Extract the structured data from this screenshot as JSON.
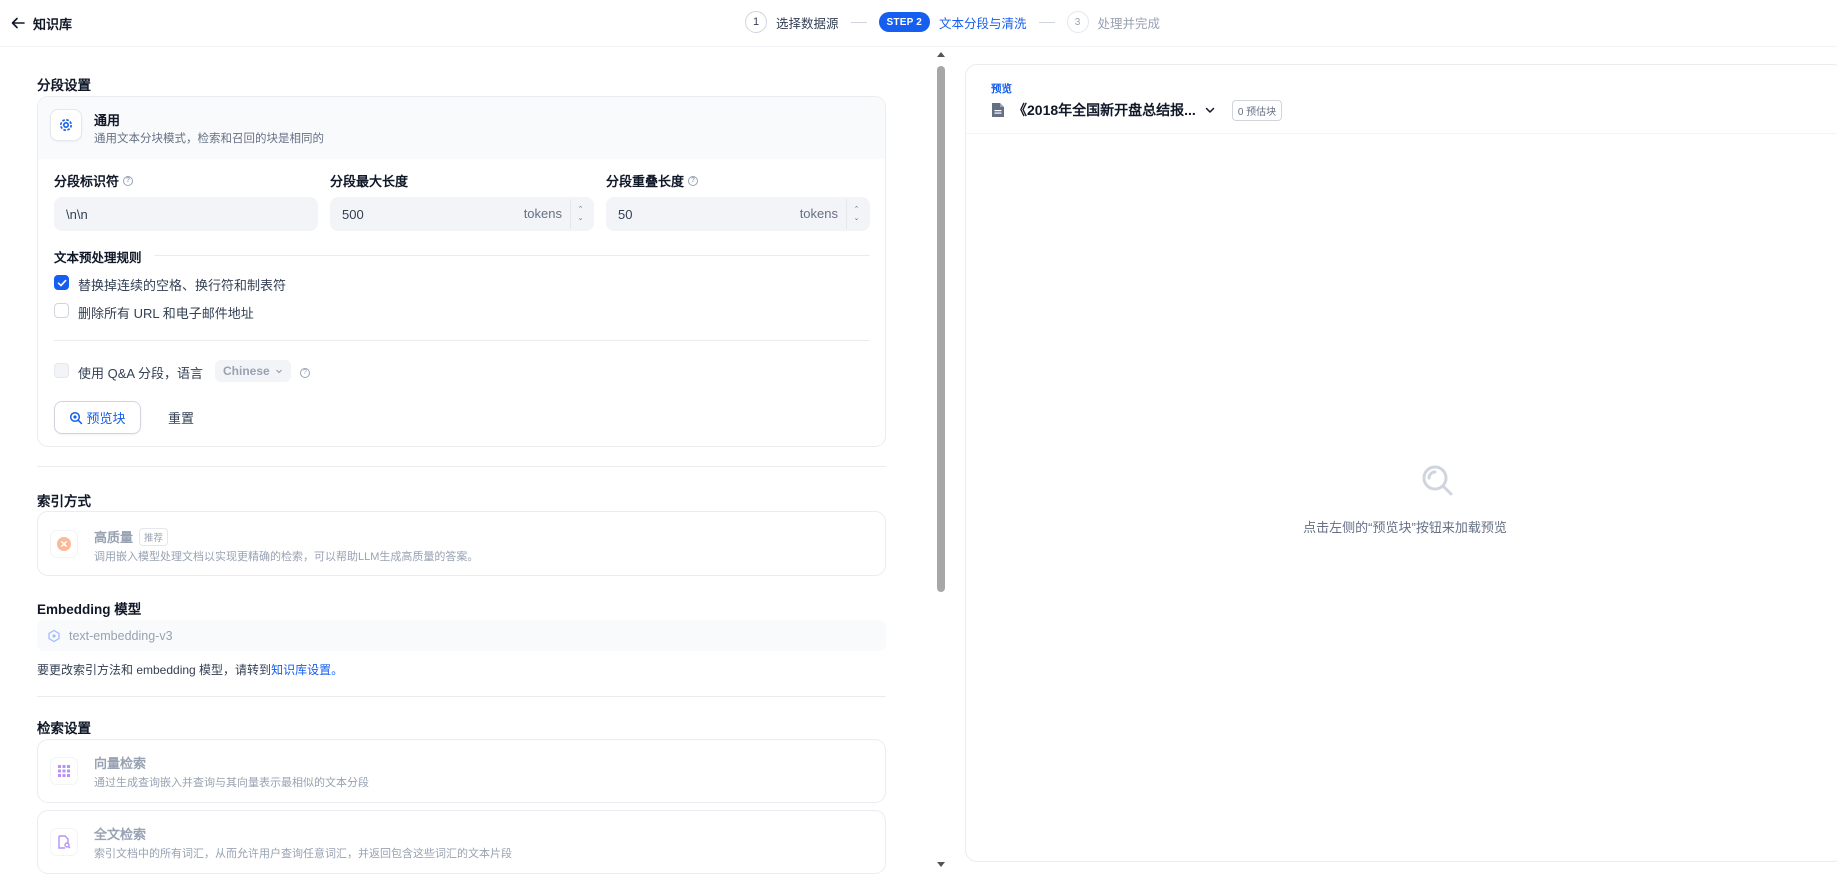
{
  "header": {
    "title": "知识库",
    "steps": [
      {
        "num": "1",
        "label": "选择数据源"
      },
      {
        "pill": "STEP 2",
        "label": "文本分段与清洗"
      },
      {
        "num": "3",
        "label": "处理并完成"
      }
    ]
  },
  "segment": {
    "section_title": "分段设置",
    "mode_title": "通用",
    "mode_desc": "通用文本分块模式，检索和召回的块是相同的",
    "delimiter_label": "分段标识符",
    "delimiter_value": "\\n\\n",
    "max_length_label": "分段最大长度",
    "max_length_value": "500",
    "overlap_label": "分段重叠长度",
    "overlap_value": "50",
    "unit": "tokens",
    "rules_title": "文本预处理规则",
    "rule1": "替换掉连续的空格、换行符和制表符",
    "rule2": "删除所有 URL 和电子邮件地址",
    "qa_label": "使用 Q&A 分段，语言",
    "qa_language": "Chinese",
    "preview_button": "预览块",
    "reset_button": "重置"
  },
  "index": {
    "section_title": "索引方式",
    "hq_title": "高质量",
    "hq_badge": "推荐",
    "hq_desc": "调用嵌入模型处理文档以实现更精确的检索，可以帮助LLM生成高质量的答案。"
  },
  "embedding": {
    "section_title": "Embedding 模型",
    "model": "text-embedding-v3",
    "hint_prefix": "要更改索引方法和 embedding 模型，请转到",
    "hint_link": "知识库设置。"
  },
  "retrieval": {
    "section_title": "检索设置",
    "vector_title": "向量检索",
    "vector_desc": "通过生成查询嵌入并查询与其向量表示最相似的文本分段",
    "fulltext_title": "全文检索",
    "fulltext_desc": "索引文档中的所有词汇，从而允许用户查询任意词汇，并返回包含这些词汇的文本片段"
  },
  "preview": {
    "tag": "预览",
    "doc_name": "《2018年全国新开盘总结报...",
    "chunk_count": "0 预估块",
    "empty_text": "点击左侧的“预览块”按钮来加载预览"
  },
  "colors": {
    "accent": "#155eef",
    "muted": "#98a2b3"
  }
}
